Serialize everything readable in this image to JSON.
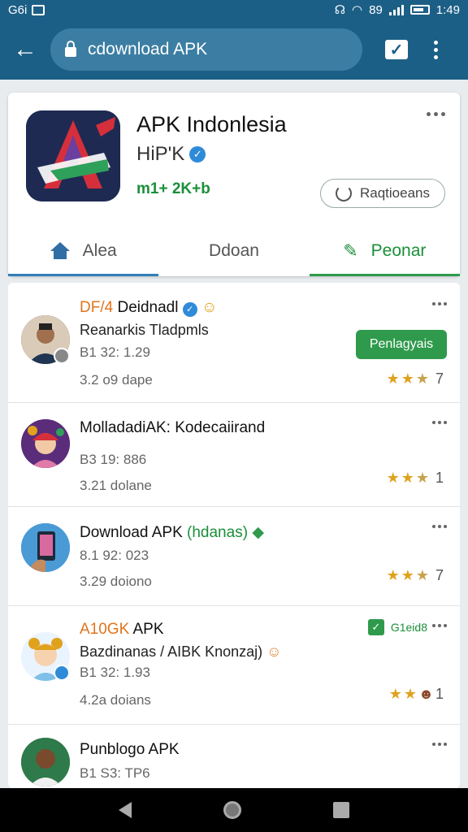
{
  "status_bar": {
    "carrier": "G6i",
    "network": "89",
    "time": "1:49"
  },
  "browser": {
    "url": "cdownload APK"
  },
  "app": {
    "title": "APK Indonlesia",
    "developer": "HiP'K",
    "meta": "m1+ 2K+b",
    "action_label": "Raqtioeans"
  },
  "tabs": [
    {
      "label": "Alea"
    },
    {
      "label": "Ddoan"
    },
    {
      "label": "Peonar"
    }
  ],
  "list": [
    {
      "title_prefix": "DF/4",
      "title": "Deidnadl",
      "subtitle": "Reanarkis Tladpmls",
      "meta1": "B1 32: 1.29",
      "meta2": "3.2 o9 dape",
      "button": "Penlagyais",
      "rating": 3.5,
      "count": "7"
    },
    {
      "title": "MolladadiAK: Kodecaiirand",
      "meta1": "B3 19: 886",
      "meta2": "3.21 dolane",
      "rating": 3.5,
      "count": "1"
    },
    {
      "title": "Download APK",
      "title_suffix": "(hdanas)",
      "meta1": "8.1 92: 023",
      "meta2": "3.29 doiono",
      "rating": 3.5,
      "count": "7"
    },
    {
      "title_prefix": "A10GK",
      "title": "APK",
      "subtitle": "Bazdinanas / AIBK Knonzaj)",
      "meta1": "B1 32: 1.93",
      "meta2": "4.2a doians",
      "badge_text": "G1eid8",
      "rating": 2.5,
      "count": "1"
    },
    {
      "title": "Punblogo APK",
      "meta1": "B1 S3: TP6"
    }
  ],
  "icons": {
    "back": "arrow-left-icon",
    "lock": "lock-icon",
    "check": "checkbox-icon",
    "more": "more-vert-icon",
    "home": "home-icon",
    "pin": "pin-icon"
  }
}
